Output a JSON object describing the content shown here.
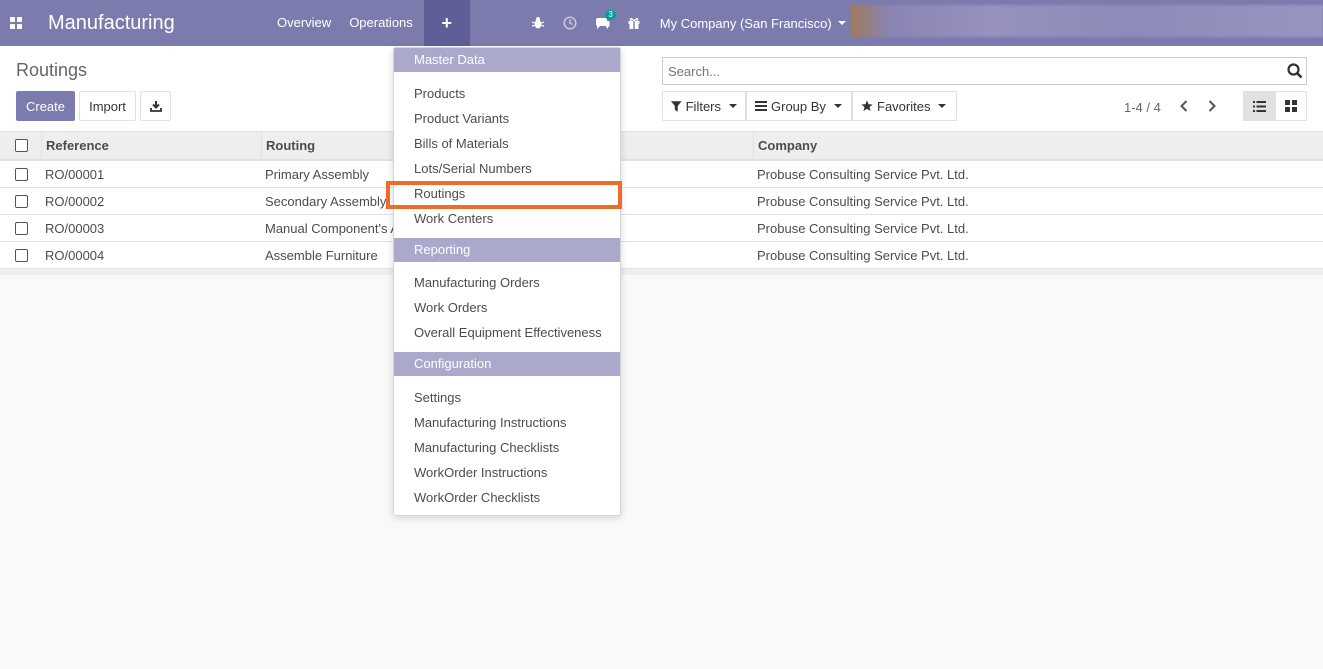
{
  "navbar": {
    "app_title": "Manufacturing",
    "menu": [
      "Overview",
      "Operations"
    ],
    "plus_symbol": "+",
    "chat_badge": "3",
    "company": "My Company (San Francisco)"
  },
  "control_panel": {
    "title": "Routings",
    "create_label": "Create",
    "import_label": "Import",
    "search_placeholder": "Search...",
    "filters_label": "Filters",
    "groupby_label": "Group By",
    "favorites_label": "Favorites",
    "pager": "1-4 / 4"
  },
  "table": {
    "columns": [
      "Reference",
      "Routing",
      "Company"
    ],
    "rows": [
      {
        "reference": "RO/00001",
        "routing": "Primary Assembly",
        "company": "Probuse Consulting Service Pvt. Ltd."
      },
      {
        "reference": "RO/00002",
        "routing": "Secondary Assembly",
        "company": "Probuse Consulting Service Pvt. Ltd."
      },
      {
        "reference": "RO/00003",
        "routing": "Manual Component's Assembly",
        "company": "Probuse Consulting Service Pvt. Ltd."
      },
      {
        "reference": "RO/00004",
        "routing": "Assemble Furniture",
        "company": "Probuse Consulting Service Pvt. Ltd."
      }
    ]
  },
  "dropdown": {
    "sections": [
      {
        "header": "Master Data",
        "items": [
          "Products",
          "Product Variants",
          "Bills of Materials",
          "Lots/Serial Numbers",
          "Routings",
          "Work Centers"
        ]
      },
      {
        "header": "Reporting",
        "items": [
          "Manufacturing Orders",
          "Work Orders",
          "Overall Equipment Effectiveness"
        ]
      },
      {
        "header": "Configuration",
        "items": [
          "Settings",
          "Manufacturing Instructions",
          "Manufacturing Checklists",
          "WorkOrder Instructions",
          "WorkOrder Checklists"
        ]
      }
    ],
    "highlighted_item": "Routings"
  },
  "icons": {
    "apps": "apps-grid-icon",
    "bug": "bug-icon",
    "clock": "clock-icon",
    "chat": "chat-icon",
    "gift": "gift-icon",
    "search": "search-icon",
    "download": "download-icon",
    "filter": "filter-icon",
    "groupby": "list-bars-icon",
    "star": "star-icon",
    "prev": "chevron-left-icon",
    "next": "chevron-right-icon",
    "list_view": "list-view-icon",
    "kanban_view": "kanban-view-icon"
  },
  "colors": {
    "brand": "#7c7bad",
    "menu_header": "#aaa9cb",
    "highlight": "#ef6b2a"
  }
}
